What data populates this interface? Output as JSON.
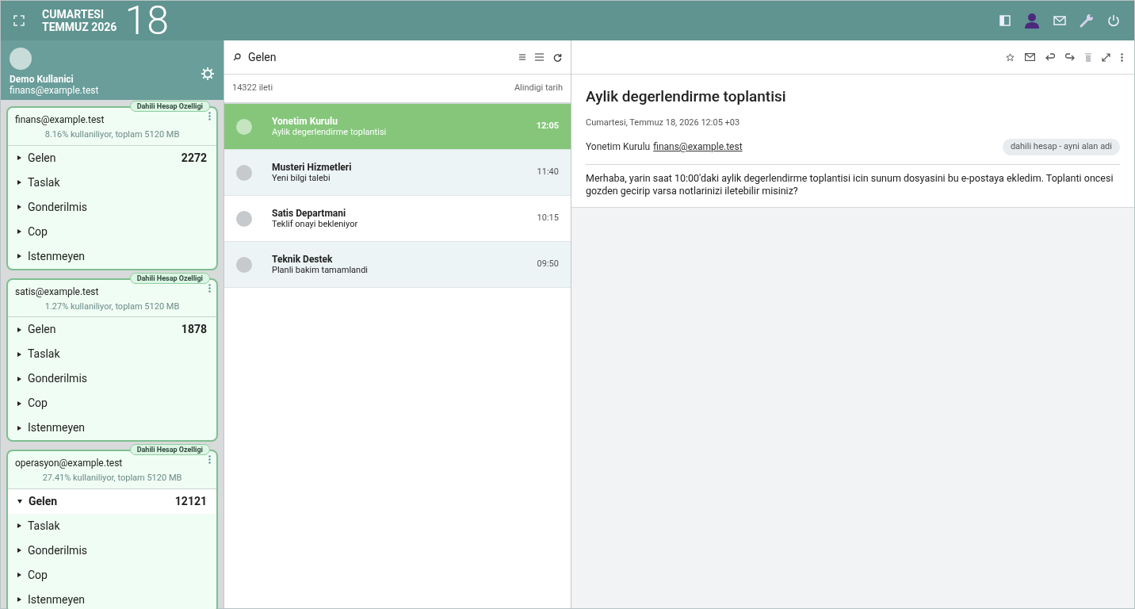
{
  "header": {
    "weekday": "CUMARTESI",
    "month_year": "TEMMUZ 2026",
    "day": "18"
  },
  "user": {
    "name": "Demo Kullanici",
    "email": "finans@example.test"
  },
  "accounts": [
    {
      "badge": "Dahili Hesap Ozelligi",
      "email": "finans@example.test",
      "usage": "8.16% kullaniliyor, toplam 5120 MB",
      "folders": [
        {
          "name": "Gelen",
          "count": "2272",
          "selected": false
        },
        {
          "name": "Taslak",
          "selected": false
        },
        {
          "name": "Gonderilmis",
          "selected": false
        },
        {
          "name": "Cop",
          "selected": false
        },
        {
          "name": "Istenmeyen",
          "selected": false
        }
      ]
    },
    {
      "badge": "Dahili Hesap Ozelligi",
      "email": "satis@example.test",
      "usage": "1.27% kullaniliyor, toplam 5120 MB",
      "folders": [
        {
          "name": "Gelen",
          "count": "1878",
          "selected": false
        },
        {
          "name": "Taslak",
          "selected": false
        },
        {
          "name": "Gonderilmis",
          "selected": false
        },
        {
          "name": "Cop",
          "selected": false
        },
        {
          "name": "Istenmeyen",
          "selected": false
        }
      ]
    },
    {
      "badge": "Dahili Hesap Ozelligi",
      "email": "operasyon@example.test",
      "usage": "27.41% kullaniliyor, toplam 5120 MB",
      "folders": [
        {
          "name": "Gelen",
          "count": "12121",
          "selected": true
        },
        {
          "name": "Taslak",
          "selected": false
        },
        {
          "name": "Gonderilmis",
          "selected": false
        },
        {
          "name": "Cop",
          "selected": false
        },
        {
          "name": "Istenmeyen",
          "selected": false
        }
      ]
    }
  ],
  "message_list": {
    "folder": "Gelen",
    "count": "14322 ileti",
    "sort": "Alindigi tarih",
    "messages": [
      {
        "sender": "Yonetim Kurulu",
        "subject": "Aylik degerlendirme toplantisi",
        "time": "12:05",
        "selected": true
      },
      {
        "sender": "Musteri Hizmetleri",
        "subject": "Yeni bilgi talebi",
        "time": "11:40",
        "selected": false
      },
      {
        "sender": "Satis Departmani",
        "subject": "Teklif onayi bekleniyor",
        "time": "10:15",
        "selected": false
      },
      {
        "sender": "Teknik Destek",
        "subject": "Planli bakim tamamlandi",
        "time": "09:50",
        "selected": false
      }
    ]
  },
  "reader": {
    "subject": "Aylik degerlendirme toplantisi",
    "date": "Cumartesi, Temmuz 18, 2026 12:05 +03",
    "from_name": "Yonetim Kurulu",
    "from_email": "finans@example.test",
    "tag": "dahili hesap - ayni alan adi",
    "body": "Merhaba, yarin saat 10:00'daki aylik degerlendirme toplantisi icin sunum dosyasini bu e-postaya ekledim. Toplanti oncesi gozden gecirip varsa notlarinizi iletebilir misiniz?"
  }
}
